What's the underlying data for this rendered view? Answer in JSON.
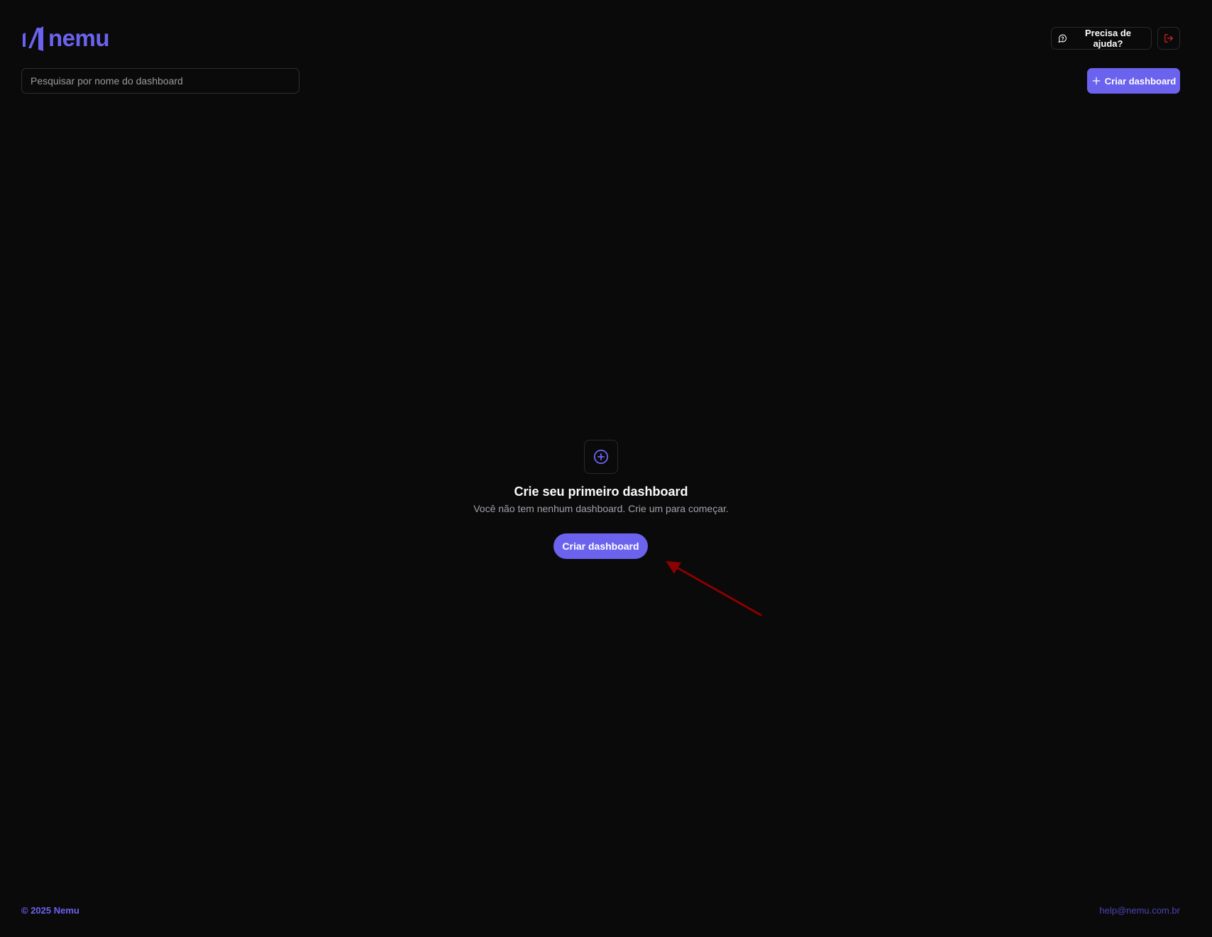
{
  "app": {
    "logo_text": "nemu"
  },
  "header": {
    "help_label": "Precisa de ajuda?",
    "help_icon": "message-circle-icon",
    "logout_icon": "log-out-icon"
  },
  "toolbar": {
    "search_placeholder": "Pesquisar por nome do dashboard",
    "search_value": "",
    "create_label": "Criar dashboard",
    "create_icon": "plus-icon"
  },
  "empty_state": {
    "icon": "plus-circle-icon",
    "title": "Crie seu primeiro dashboard",
    "description": "Você não tem nenhum dashboard. Crie um para começar.",
    "button_label": "Criar dashboard"
  },
  "footer": {
    "copyright": "© 2025 Nemu",
    "email": "help@nemu.com.br"
  },
  "colors": {
    "background": "#0a0a0a",
    "accent": "#6b63ee",
    "border": "#2a2a2a",
    "muted_text": "#a1a1aa",
    "danger": "#dc2626",
    "annotation_arrow": "#8b0000"
  }
}
